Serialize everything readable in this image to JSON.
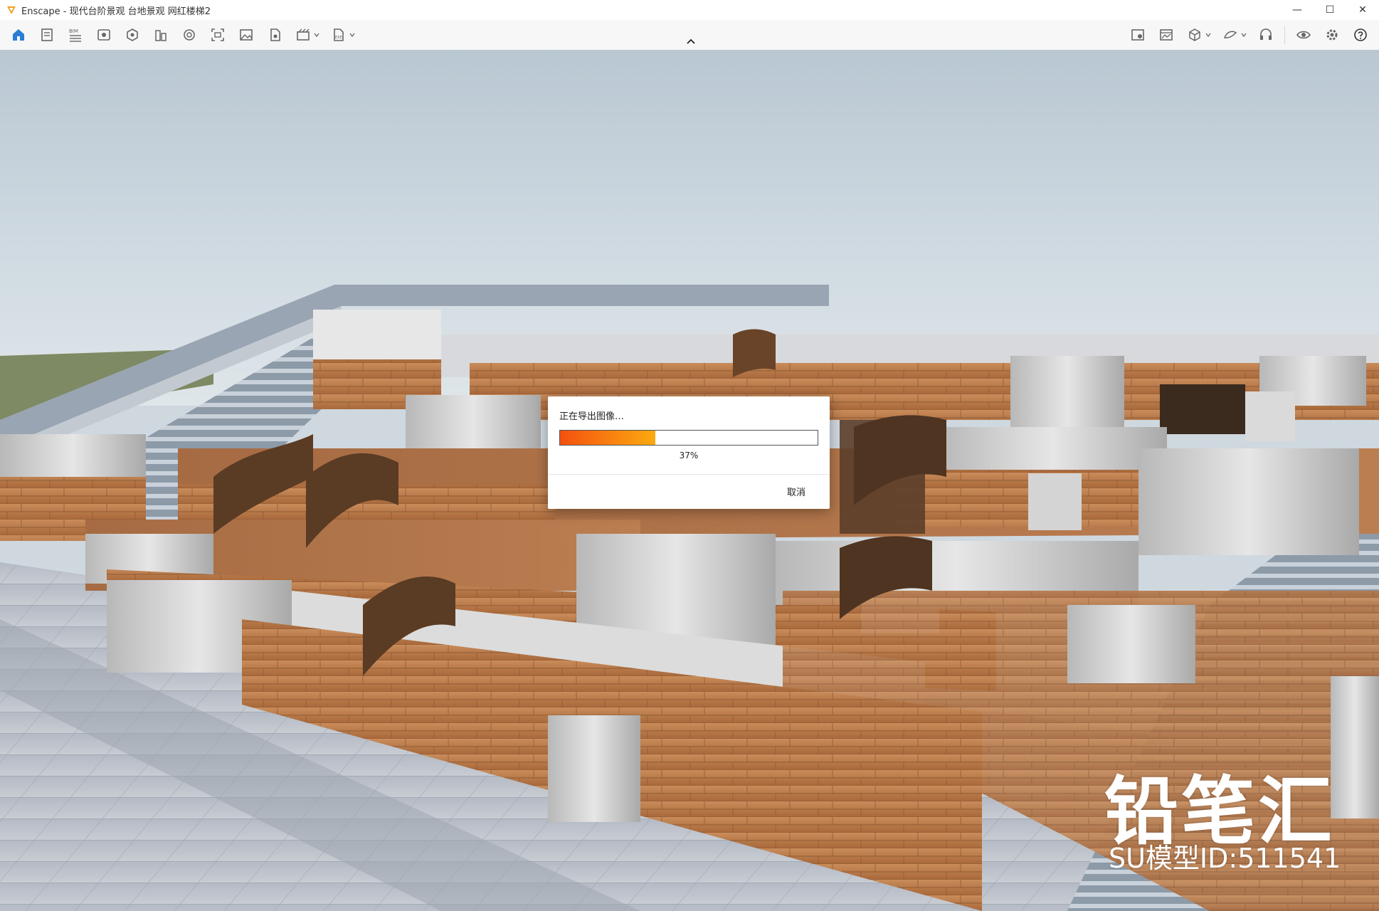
{
  "window": {
    "title": "Enscape - 现代台阶景观 台地景观 网红楼梯2",
    "controls": {
      "minimize": "—",
      "maximize": "☐",
      "close": "✕"
    }
  },
  "toolbar": {
    "left_icons": [
      "home-icon",
      "notes-icon",
      "bim-icon",
      "view-icon",
      "capture-icon",
      "building-icon",
      "vr-icon",
      "screenshot-icon",
      "image-icon",
      "asset-icon",
      "video-icon",
      "export-exe-icon"
    ],
    "right_icons": [
      "material-icon",
      "render-icon",
      "cube-icon",
      "sketch-icon",
      "headset-icon",
      "visual-settings-icon",
      "settings-icon",
      "help-icon"
    ]
  },
  "dialog": {
    "title": "正在导出图像…",
    "progress_percent": 37,
    "progress_label": "37%",
    "cancel_label": "取消"
  },
  "watermark": {
    "brand": "铅笔汇",
    "model_id": "SU模型ID:511541"
  },
  "colors": {
    "accent": "#f98a10",
    "progress_start": "#f5500f",
    "app_logo": "#f0a020"
  }
}
